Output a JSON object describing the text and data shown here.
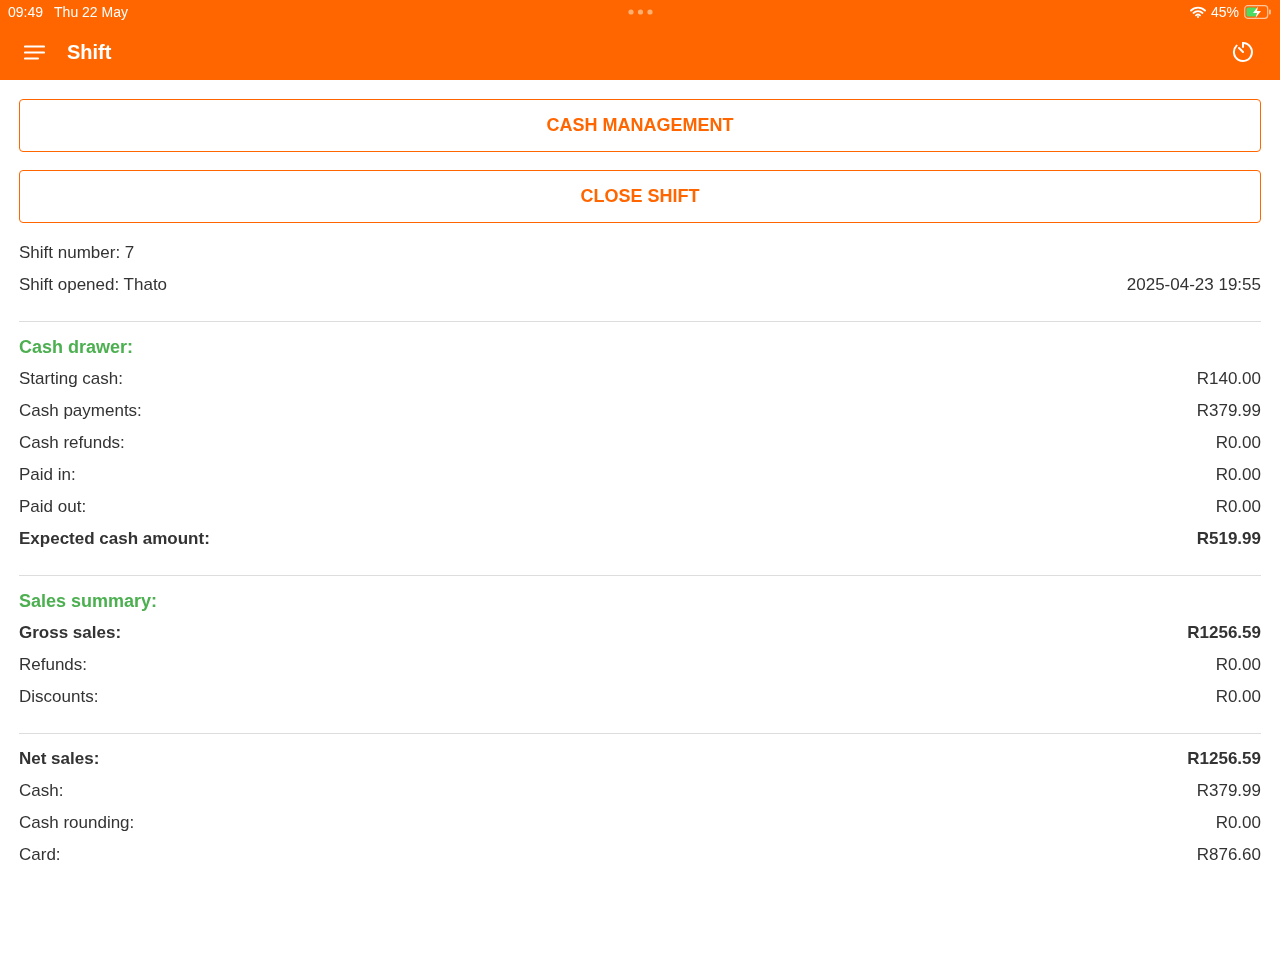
{
  "status_bar": {
    "time": "09:49",
    "date": "Thu 22 May",
    "battery": "45%"
  },
  "toolbar": {
    "title": "Shift"
  },
  "buttons": [
    "CASH MANAGEMENT",
    "CLOSE SHIFT"
  ],
  "shift_info": [
    {
      "label": "Shift number: 7",
      "bold": false
    },
    {
      "label": "Shift opened: Thato",
      "value": "2025-04-23 19:55",
      "bold": false
    }
  ],
  "sections": [
    {
      "heading": "Cash drawer:",
      "rows": [
        {
          "label": "Starting cash:",
          "value": "R140.00",
          "bold": false
        },
        {
          "label": "Cash payments:",
          "value": "R379.99",
          "bold": false
        },
        {
          "label": "Cash refunds:",
          "value": "R0.00",
          "bold": false
        },
        {
          "label": "Paid in:",
          "value": "R0.00",
          "bold": false
        },
        {
          "label": "Paid out:",
          "value": "R0.00",
          "bold": false
        },
        {
          "label": "Expected cash amount:",
          "value": "R519.99",
          "bold": true
        }
      ]
    },
    {
      "heading": "Sales summary:",
      "rows": [
        {
          "label": "Gross sales:",
          "value": "R1256.59",
          "bold": true
        },
        {
          "label": "Refunds:",
          "value": "R0.00",
          "bold": false
        },
        {
          "label": "Discounts:",
          "value": "R0.00",
          "bold": false
        }
      ]
    },
    {
      "rows": [
        {
          "label": "Net sales:",
          "value": "R1256.59",
          "bold": true
        },
        {
          "label": "Cash:",
          "value": "R379.99",
          "bold": false
        },
        {
          "label": "Cash rounding:",
          "value": "R0.00",
          "bold": false
        },
        {
          "label": "Card:",
          "value": "R876.60",
          "bold": false
        }
      ]
    }
  ]
}
